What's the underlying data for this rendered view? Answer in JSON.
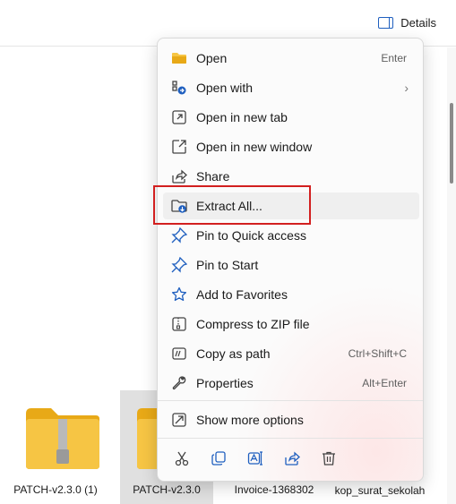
{
  "toolbar": {
    "details_label": "Details"
  },
  "files": [
    {
      "name": "PATCH-v2.3.0 (1)",
      "selected": false
    },
    {
      "name": "PATCH-v2.3.0",
      "selected": true
    },
    {
      "name": "Invoice-1368302",
      "selected": false
    },
    {
      "name": "kop_surat_sekolah",
      "selected": false
    }
  ],
  "context_menu": {
    "items": [
      {
        "label": "Open",
        "shortcut": "Enter",
        "icon": "folder-open-icon"
      },
      {
        "label": "Open with",
        "shortcut": "",
        "icon": "open-with-icon",
        "submenu": true
      },
      {
        "label": "Open in new tab",
        "shortcut": "",
        "icon": "new-tab-icon"
      },
      {
        "label": "Open in new window",
        "shortcut": "",
        "icon": "new-window-icon"
      },
      {
        "label": "Share",
        "shortcut": "",
        "icon": "share-icon"
      },
      {
        "label": "Extract All...",
        "shortcut": "",
        "icon": "extract-icon",
        "highlighted": true
      },
      {
        "label": "Pin to Quick access",
        "shortcut": "",
        "icon": "pin-icon"
      },
      {
        "label": "Pin to Start",
        "shortcut": "",
        "icon": "pin-start-icon"
      },
      {
        "label": "Add to Favorites",
        "shortcut": "",
        "icon": "star-icon"
      },
      {
        "label": "Compress to ZIP file",
        "shortcut": "",
        "icon": "zip-icon"
      },
      {
        "label": "Copy as path",
        "shortcut": "Ctrl+Shift+C",
        "icon": "copy-path-icon"
      },
      {
        "label": "Properties",
        "shortcut": "Alt+Enter",
        "icon": "wrench-icon"
      }
    ],
    "show_more": {
      "label": "Show more options",
      "icon": "show-more-icon"
    },
    "actions": [
      "cut-icon",
      "copy-icon",
      "rename-icon",
      "share-icon",
      "delete-icon"
    ]
  },
  "colors": {
    "accent": "#1f5fbf",
    "highlight_border": "#d21f1f",
    "folder": "#f6c544"
  }
}
